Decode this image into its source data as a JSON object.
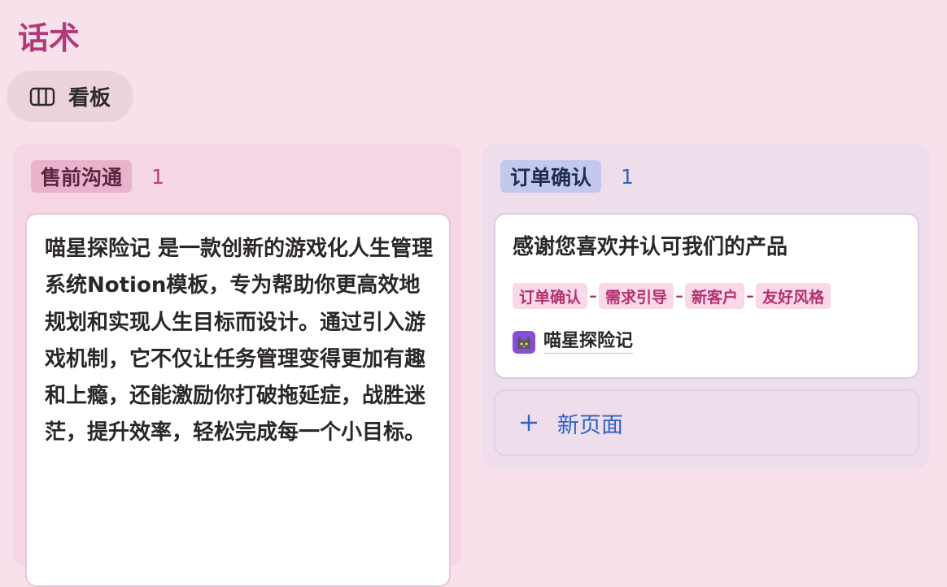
{
  "page": {
    "title": "话术"
  },
  "view_tab": {
    "label": "看板",
    "icon": "board-columns-icon"
  },
  "columns": [
    {
      "label": "售前沟通",
      "count": "1",
      "color": "#e9b4cb",
      "cards": [
        {
          "text": "喵星探险记 是一款创新的游戏化人生管理系统Notion模板，专为帮助你更高效地规划和实现人生目标而设计。通过引入游戏机制，它不仅让任务管理变得更加有趣和上瘾，还能激励你打破拖延症，战胜迷茫，提升效率，轻松完成每一个小目标。"
        }
      ]
    },
    {
      "label": "订单确认",
      "count": "1",
      "color": "#c3c9ec",
      "cards": [
        {
          "title": "感谢您喜欢并认可我们的产品",
          "tags": [
            "订单确认",
            "需求引导",
            "新客户",
            "友好风格"
          ],
          "owner": {
            "name": "喵星探险记",
            "avatar_icon": "cat-avatar-icon"
          }
        }
      ],
      "new_page_label": "新页面"
    }
  ]
}
